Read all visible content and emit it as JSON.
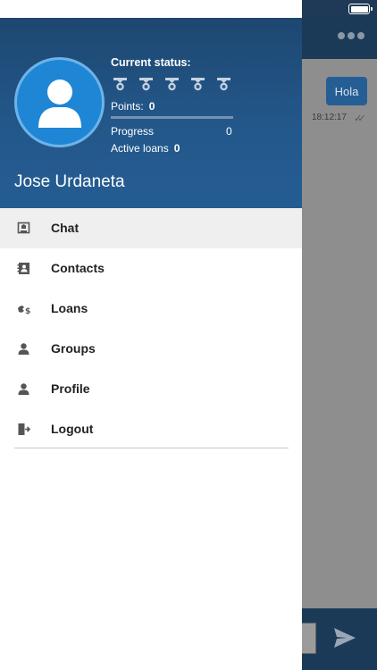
{
  "profile": {
    "status_label": "Current status:",
    "points_label": "Points:",
    "points_value": "0",
    "progress_label": "Progress",
    "progress_value": "0",
    "progress_fraction": 0,
    "active_loans_label": "Active loans",
    "active_loans_value": "0",
    "user_name": "Jose Urdaneta",
    "badge_count": 5,
    "avatar_icon": "user-avatar-icon"
  },
  "menu": {
    "items": [
      {
        "label": "Chat",
        "icon": "chat-icon",
        "active": true
      },
      {
        "label": "Contacts",
        "icon": "contacts-icon",
        "active": false
      },
      {
        "label": "Loans",
        "icon": "loans-icon",
        "active": false
      },
      {
        "label": "Groups",
        "icon": "groups-icon",
        "active": false
      },
      {
        "label": "Profile",
        "icon": "profile-icon",
        "active": false
      },
      {
        "label": "Logout",
        "icon": "logout-icon",
        "active": false
      }
    ]
  },
  "background_chat": {
    "message_text": "Hola",
    "message_time": "18:12:17"
  },
  "colors": {
    "header_blue": "#23578a",
    "avatar_blue": "#1f86d6",
    "dark_navy": "#1b3a57",
    "active_item_bg": "#efefef"
  }
}
